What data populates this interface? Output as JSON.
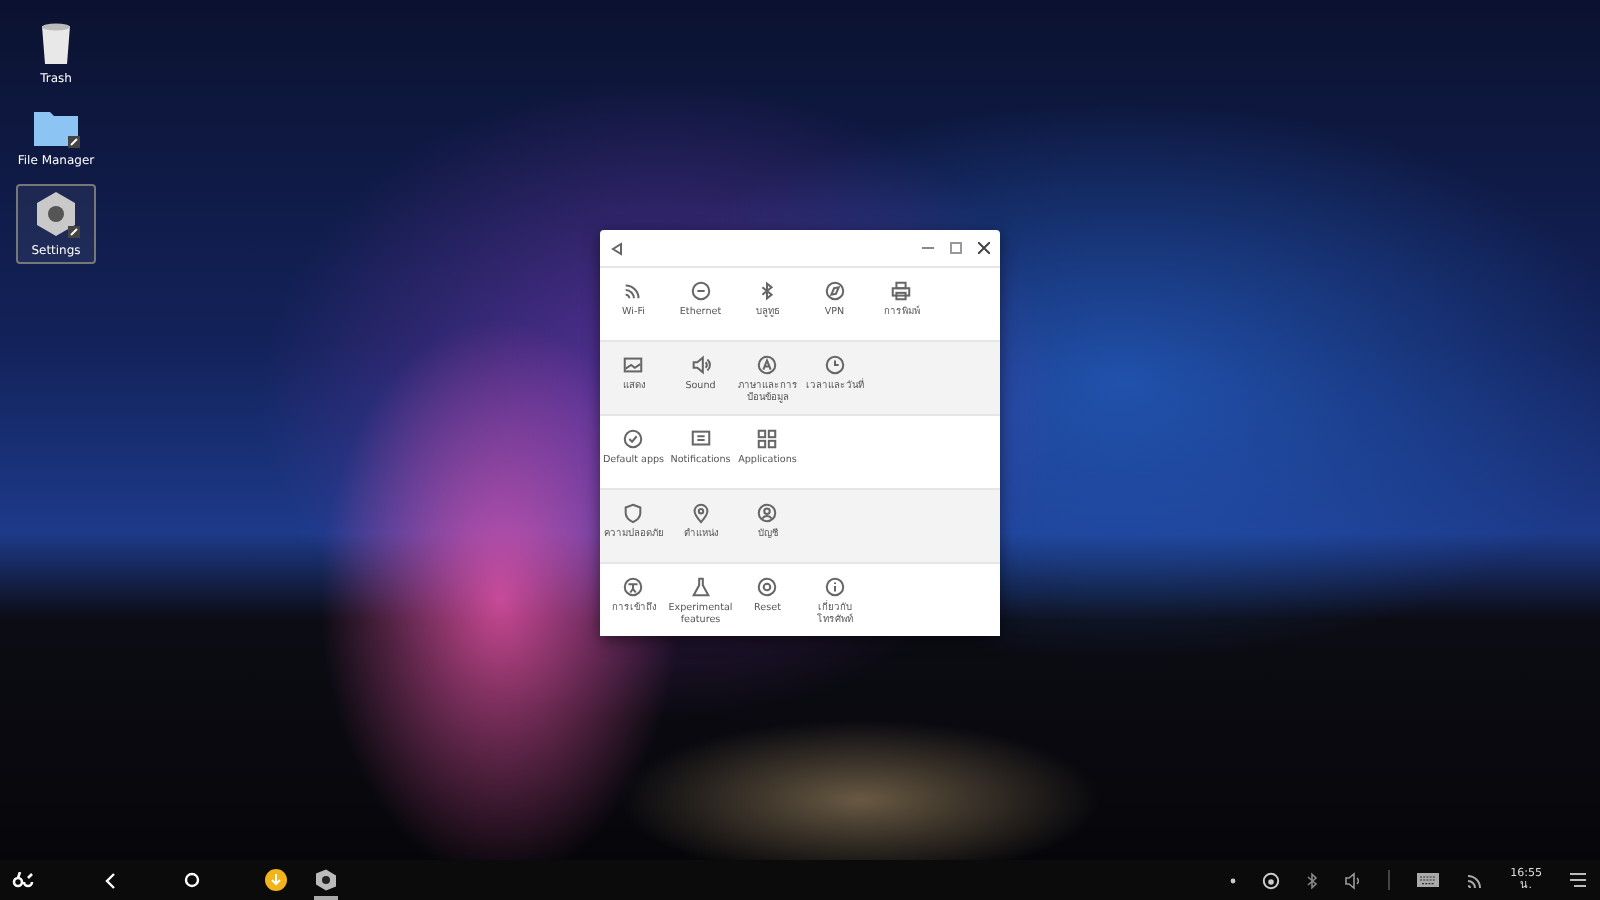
{
  "desktop_icons": [
    {
      "label": "Trash",
      "selected": false
    },
    {
      "label": "File Manager",
      "selected": false
    },
    {
      "label": "Settings",
      "selected": true
    }
  ],
  "settings_window": {
    "rows": [
      {
        "shaded": false,
        "items": [
          {
            "label": "Wi-Fi"
          },
          {
            "label": "Ethernet"
          },
          {
            "label": "บลูทูธ"
          },
          {
            "label": "VPN"
          },
          {
            "label": "การพิมพ์"
          }
        ]
      },
      {
        "shaded": true,
        "items": [
          {
            "label": "แสดง"
          },
          {
            "label": "Sound"
          },
          {
            "label": "ภาษาและการป้อนข้อมูล"
          },
          {
            "label": "เวลาและวันที่"
          }
        ]
      },
      {
        "shaded": false,
        "items": [
          {
            "label": "Default apps"
          },
          {
            "label": "Notifications"
          },
          {
            "label": "Applications"
          }
        ]
      },
      {
        "shaded": true,
        "items": [
          {
            "label": "ความปลอดภัย"
          },
          {
            "label": "ตำแหน่ง"
          },
          {
            "label": "บัญชี"
          }
        ]
      },
      {
        "shaded": false,
        "items": [
          {
            "label": "การเข้าถึง"
          },
          {
            "label": "Experimental features"
          },
          {
            "label": "Reset"
          },
          {
            "label": "เกี่ยวกับโทรศัพท์"
          }
        ]
      }
    ]
  },
  "taskbar": {
    "running_apps": [
      {
        "active": false
      },
      {
        "active": true
      }
    ],
    "clock": {
      "time": "16:55",
      "period": "น."
    }
  }
}
